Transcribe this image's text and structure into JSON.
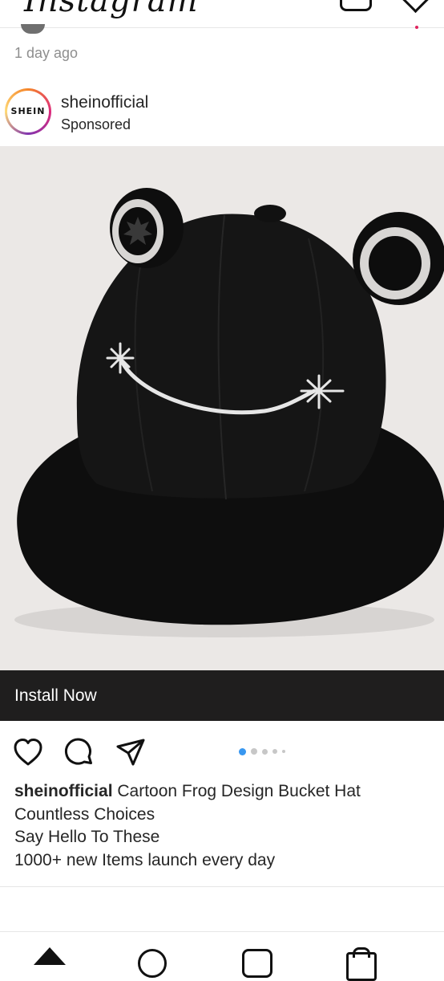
{
  "app": {
    "logo_text": "Instagram"
  },
  "previous_post": {
    "time_ago": "1 day ago"
  },
  "post": {
    "avatar_text": "SHEIN",
    "username": "sheinofficial",
    "sponsored_label": "Sponsored",
    "cta_label": "Install Now",
    "carousel": {
      "total": 5,
      "active_index": 0
    },
    "caption": {
      "username": "sheinofficial",
      "lines": [
        "Cartoon Frog Design Bucket Hat",
        "Countless Choices",
        "Say Hello To These",
        "1000+ new Items launch every day"
      ]
    }
  },
  "colors": {
    "cta_background": "#1f1e1e",
    "carousel_active": "#3897f0",
    "carousel_inactive": "#c7c7c7",
    "image_background": "#ebe8e6"
  },
  "icons": {
    "actions": [
      "heart-icon",
      "comment-icon",
      "send-icon"
    ],
    "nav": [
      "home-icon",
      "search-icon",
      "reels-icon",
      "shop-icon"
    ]
  }
}
